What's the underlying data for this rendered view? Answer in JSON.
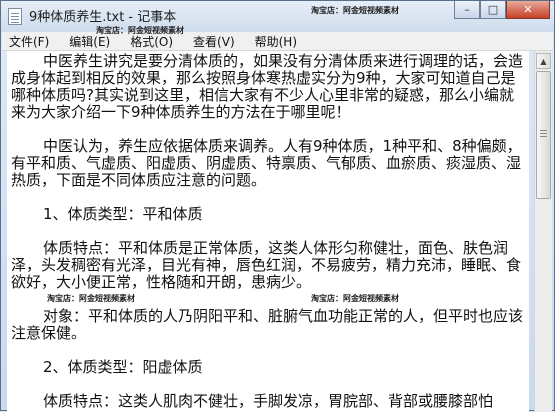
{
  "window": {
    "title": "9种体质养生.txt - 记事本",
    "buttons": {
      "minimize": "–",
      "maximize": "□",
      "close": "✕"
    }
  },
  "menu": {
    "items": [
      {
        "label": "文件(F)"
      },
      {
        "label": "编辑(E)"
      },
      {
        "label": "格式(O)"
      },
      {
        "label": "查看(V)"
      },
      {
        "label": "帮助(H)"
      }
    ]
  },
  "watermarks": {
    "text": "淘宝店：阿金短视频素材"
  },
  "document": {
    "paragraphs": [
      "中医养生讲究是要分清体质的，如果没有分清体质来进行调理的话，会造成身体起到相反的效果，那么按照身体寒热虚实分为9种，大家可知道自己是哪种体质吗?其实说到这里，相信大家有不少人心里非常的疑惑，那么小编就来为大家介绍一下9种体质养生的方法在于哪里呢！",
      "中医认为，养生应依据体质来调养。人有9种体质，1种平和、8种偏颇，有平和质、气虚质、阳虚质、阴虚质、特禀质、气郁质、血瘀质、痰湿质、湿热质，下面是不同体质应注意的问题。",
      "1、体质类型：平和体质",
      "体质特点：平和体质是正常体质，这类人体形匀称健壮，面色、肤色润泽，头发稠密有光泽，目光有神，唇色红润，不易疲劳，精力充沛，睡眠、食欲好，大小便正常，性格随和开朗，患病少。",
      "对象：平和体质的人乃阴阳平和、脏腑气血功能正常的人，但平时也应该注意保健。",
      "2、体质类型：阳虚体质",
      "体质特点：这类人肌肉不健壮，手脚发凉，胃脘部、背部或腰膝部怕"
    ]
  }
}
